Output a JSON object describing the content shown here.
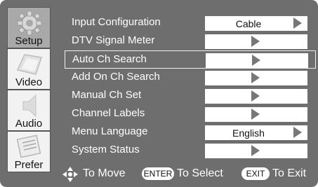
{
  "sidebar": {
    "tabs": [
      {
        "label": "Setup",
        "icon": "gear-icon",
        "active": true
      },
      {
        "label": "Video",
        "icon": "tv-screen-icon",
        "active": false
      },
      {
        "label": "Audio",
        "icon": "speaker-icon",
        "active": false
      },
      {
        "label": "Prefer",
        "icon": "preferences-icon",
        "active": false
      }
    ]
  },
  "menu": {
    "items": [
      {
        "label": "Input Configuration",
        "value": "Cable",
        "control": "select"
      },
      {
        "label": "DTV Signal Meter",
        "value": "",
        "control": "enter"
      },
      {
        "label": "Auto Ch Search",
        "value": "",
        "control": "enter",
        "selected": true
      },
      {
        "label": "Add On Ch Search",
        "value": "",
        "control": "enter"
      },
      {
        "label": "Manual Ch Set",
        "value": "",
        "control": "enter"
      },
      {
        "label": "Channel Labels",
        "value": "",
        "control": "enter"
      },
      {
        "label": "Menu Language",
        "value": "English",
        "control": "select"
      },
      {
        "label": "System Status",
        "value": "",
        "control": "enter"
      }
    ]
  },
  "footer": {
    "move_text": "To Move",
    "enter_key": "ENTER",
    "select_text": "To Select",
    "exit_key": "EXIT",
    "exit_text": "To Exit"
  },
  "colors": {
    "background": "#6e6e6e",
    "active_tab": "#a9a9a9",
    "inactive_tab": "#f2f2f2",
    "text": "#ffffff",
    "value_box": "#ffffff"
  }
}
